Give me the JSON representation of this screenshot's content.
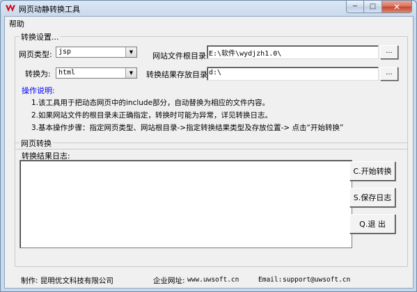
{
  "window": {
    "title": "网页动静转换工具",
    "minimize_glyph": "─",
    "maximize_glyph": "□",
    "close_glyph": "✕"
  },
  "menu": {
    "help": "帮助"
  },
  "settings": {
    "legend": "转换设置...",
    "page_type_label": "网页类型:",
    "page_type_value": "jsp",
    "convert_to_label": "转换为:",
    "convert_to_value": "html",
    "site_root_label": "网站文件根目录:",
    "site_root_value": "E:\\软件\\wydjzh1.0\\",
    "output_dir_label": "转换结果存放目录:",
    "output_dir_value": "d:\\",
    "browse_label": "...",
    "dropdown_glyph": "▼"
  },
  "instructions": {
    "title": "操作说明:",
    "lines": [
      "1.该工具用于把动态网页中的include部分，自动替换为相应的文件内容。",
      "2.如果网站文件的根目录未正确指定，转换时可能为异常，详见转换日志。",
      "3.基本操作步骤：指定网页类型、网站根目录->指定转换结果类型及存放位置-> 点击“开始转换”"
    ]
  },
  "conversion": {
    "legend": "网页转换",
    "log_label": "转换结果日志:",
    "log_text": "",
    "start_button": "C.开始转换",
    "save_log_button": "S.保存日志",
    "exit_button": "Q.退 出"
  },
  "footer": {
    "maker": "制作: 昆明优文科技有限公司",
    "website_label": "企业网址:",
    "website_value": "www.uwsoft.cn",
    "email_label": "Email:",
    "email_value": "support@uwsoft.cn"
  },
  "colors": {
    "accent_blue": "#0000ff",
    "title_bar": "#c8d9ec",
    "logo_red": "#d0021b"
  }
}
